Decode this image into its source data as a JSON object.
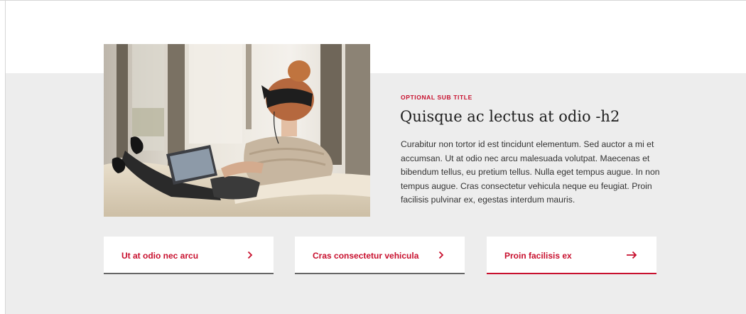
{
  "feature": {
    "sub_title": "OPTIONAL SUB TITLE",
    "heading": "Quisque ac lectus at odio -h2",
    "body": "Curabitur non tortor id est tincidunt elementum. Sed auctor a mi et accumsan. Ut at odio nec arcu malesuada volutpat. Maecenas et bibendum tellus, eu pretium tellus. Nulla eget tempus augue. In non tempus augue. Cras consectetur vehicula neque eu feugiat. Proin facilisis pulvinar ex, egestas interdum mauris.",
    "image_description": "woman-with-laptop-on-sofa-photo"
  },
  "links": [
    {
      "label": "Ut at odio nec arcu",
      "icon": "chevron-right-icon"
    },
    {
      "label": "Cras consectetur vehicula",
      "icon": "chevron-right-icon"
    },
    {
      "label": "Proin facilisis ex",
      "icon": "arrow-right-icon",
      "active": true
    }
  ],
  "colors": {
    "accent": "#c8102e",
    "band_background": "#ededed",
    "card_underline": "#666666"
  }
}
